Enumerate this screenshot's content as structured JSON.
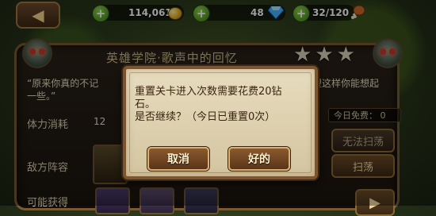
{
  "topbar": {
    "back_icon": "arrow-left-icon",
    "gold": "114,061",
    "gems": "48",
    "stamina": "32/120"
  },
  "level": {
    "title": "英雄学院·歌声中的回忆",
    "stars": [
      "★",
      "★",
      "★"
    ],
    "quote_line1": "“原来你真的不记",
    "quote_line2": "一些。”",
    "quote_right": "望这样你能想起",
    "stamina_label": "体力消耗",
    "stamina_cost": "12",
    "enemy_label": "敌方阵容",
    "drops_label": "可能获得",
    "free_today": "今日免费：  0",
    "cannot_sweep": "无法扫荡",
    "sweep": "扫荡"
  },
  "dialog": {
    "line1": "重置关卡进入次数需要花费20钻",
    "line2": "石。",
    "line3": "是否继续？（今日已重置0次）",
    "cancel_label": "取消",
    "ok_label": "好的"
  },
  "colors": {
    "dialog_bg": "#e7dcbf",
    "button_bg": "#8a5a2e",
    "accent_green": "#3a7a1a"
  }
}
